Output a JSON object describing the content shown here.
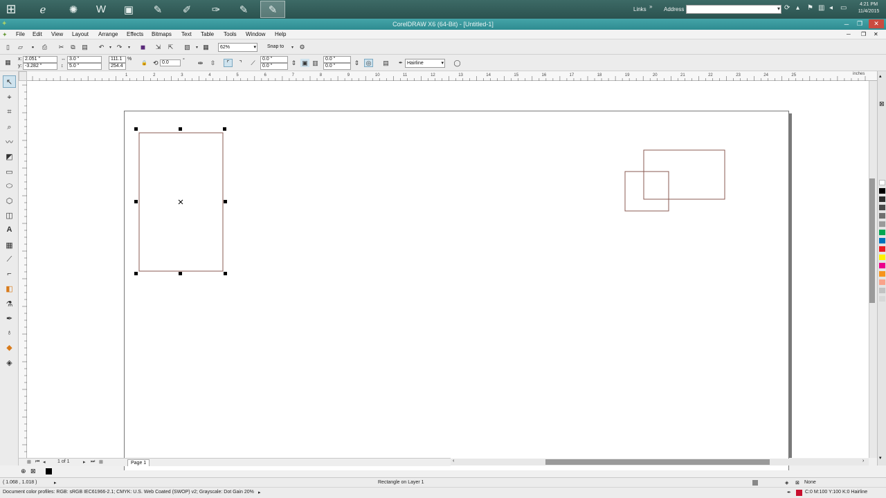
{
  "taskbar": {
    "links_label": "Links",
    "address_label": "Address",
    "address_value": "",
    "clock_time": "4:21 PM",
    "clock_date": "11/4/2015"
  },
  "window": {
    "title": "CorelDRAW X6 (64-Bit) - [Untitled-1]"
  },
  "menu": {
    "items": [
      "File",
      "Edit",
      "View",
      "Layout",
      "Arrange",
      "Effects",
      "Bitmaps",
      "Text",
      "Table",
      "Tools",
      "Window",
      "Help"
    ]
  },
  "standard_toolbar": {
    "zoom_value": "62%",
    "snap_label": "Snap to"
  },
  "property_bar": {
    "x_label": "x:",
    "x_value": "2.051 \"",
    "y_label": "y:",
    "y_value": "-3.282 \"",
    "width_value": "3.0 \"",
    "height_value": "5.0 \"",
    "scale_w": "111.1",
    "scale_h": "254.4",
    "rotation_value": "0.0",
    "corner_1": "0.0 \"",
    "corner_2": "0.0 \"",
    "corner_3": "0.0 \"",
    "corner_4": "0.0 \"",
    "outline_value": "Hairline"
  },
  "rulers": {
    "horizontal_ticks": [
      "1",
      "2",
      "3",
      "4",
      "5",
      "6",
      "7",
      "8",
      "9",
      "10",
      "11",
      "12",
      "13",
      "14",
      "15",
      "16",
      "17",
      "18",
      "19",
      "20",
      "21",
      "22",
      "23",
      "24",
      "25"
    ],
    "units": "inches"
  },
  "page_nav": {
    "counter": "1 of 1",
    "page_tab": "Page 1"
  },
  "status": {
    "cursor_position": "( 1.068 , 1.018 )",
    "selection_info": "Rectangle on Layer 1",
    "fill_label": "None",
    "color_profiles": "Document color profiles: RGB: sRGB IEC61966-2.1; CMYK: U.S. Web Coated (SWOP) v2; Grayscale: Dot Gain 20%",
    "outline_info": "C:0 M:100 Y:100 K:0  Hairline"
  },
  "colors": {
    "shape_stroke": "#8a5a52",
    "taskbar": "#2f5a56",
    "titlebar": "#3a9ca0"
  },
  "palette": [
    "#ffffff",
    "#000000",
    "#2d2d2d",
    "#4a4a4a",
    "#6f6f6f",
    "#9a9a9a",
    "#00a651",
    "#0072bc",
    "#ed1c24",
    "#fff200",
    "#ec008c",
    "#f7941d",
    "#f9a38b",
    "#c2c2c2",
    "#d8d8d8"
  ]
}
